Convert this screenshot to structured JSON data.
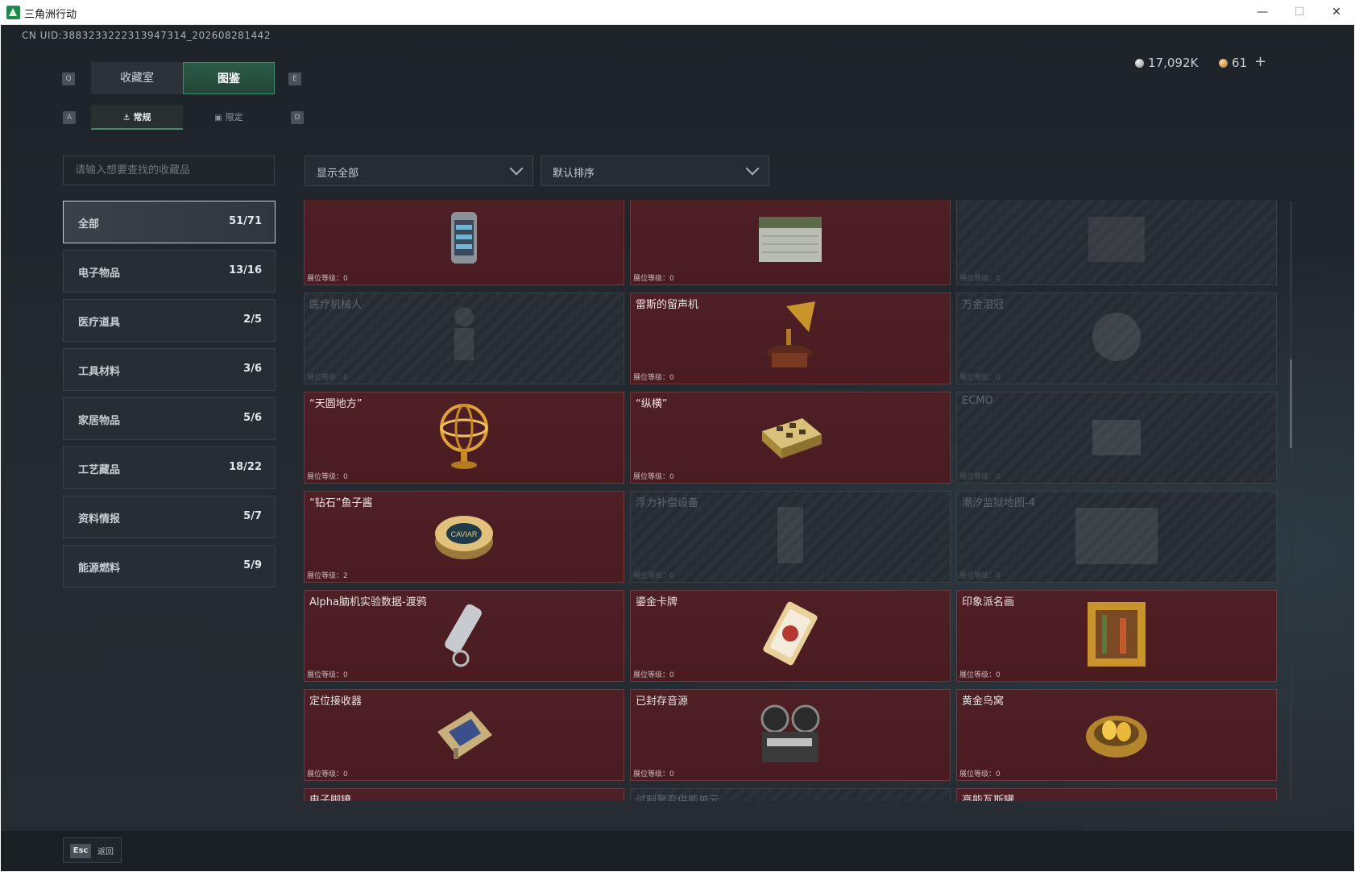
{
  "window": {
    "title": "三角洲行动"
  },
  "uid_text": "CN UID:3883233222313947314_202608281442",
  "currency": {
    "silver": "17,092K",
    "gold": "61",
    "add_label": "+"
  },
  "tabs": [
    {
      "label": "收藏室",
      "key": "Q"
    },
    {
      "label": "图鉴",
      "key": "E"
    }
  ],
  "subtabs": [
    {
      "label": "常规",
      "key": "A"
    },
    {
      "label": "限定",
      "key": "D"
    }
  ],
  "search": {
    "placeholder": "请输入想要查找的收藏品"
  },
  "filters": {
    "display": "显示全部",
    "sort": "默认排序"
  },
  "categories": [
    {
      "label": "全部",
      "count": "51/71"
    },
    {
      "label": "电子物品",
      "count": "13/16"
    },
    {
      "label": "医疗道具",
      "count": "2/5"
    },
    {
      "label": "工具材料",
      "count": "3/6"
    },
    {
      "label": "家居物品",
      "count": "5/6"
    },
    {
      "label": "工艺藏品",
      "count": "18/22"
    },
    {
      "label": "资料情报",
      "count": "5/7"
    },
    {
      "label": "能源燃料",
      "count": "5/9"
    }
  ],
  "level_prefix": "展位等级：",
  "items": [
    {
      "name": "",
      "level": "0",
      "owned": true,
      "icon": "server-core-icon"
    },
    {
      "name": "",
      "level": "0",
      "owned": true,
      "icon": "military-crate-icon"
    },
    {
      "name": "",
      "level": "0",
      "owned": false,
      "icon": "crate-icon"
    },
    {
      "name": "医疗机械人",
      "level": "0",
      "owned": false,
      "icon": "robot-icon"
    },
    {
      "name": "雷斯的留声机",
      "level": "0",
      "owned": true,
      "icon": "gramophone-icon"
    },
    {
      "name": "万金泪冠",
      "level": "0",
      "owned": false,
      "icon": "crown-icon"
    },
    {
      "name": "“天圆地方”",
      "level": "0",
      "owned": true,
      "icon": "armillary-sphere-icon"
    },
    {
      "name": "“纵横”",
      "level": "0",
      "owned": true,
      "icon": "chessboard-icon"
    },
    {
      "name": "ECMO",
      "level": "0",
      "owned": false,
      "icon": "ecmo-icon"
    },
    {
      "name": "“钻石”鱼子酱",
      "level": "2",
      "owned": true,
      "icon": "caviar-tin-icon"
    },
    {
      "name": "浮力补偿设备",
      "level": "0",
      "owned": false,
      "icon": "buoyancy-device-icon"
    },
    {
      "name": "潮汐监狱地图-4",
      "level": "0",
      "owned": false,
      "icon": "map-icon"
    },
    {
      "name": "Alpha脑机实验数据-渡鸦",
      "level": "0",
      "owned": true,
      "icon": "data-cylinder-icon"
    },
    {
      "name": "鎏金卡牌",
      "level": "0",
      "owned": true,
      "icon": "gilded-card-icon"
    },
    {
      "name": "印象派名画",
      "level": "0",
      "owned": true,
      "icon": "framed-painting-icon"
    },
    {
      "name": "定位接收器",
      "level": "0",
      "owned": true,
      "icon": "locator-receiver-icon"
    },
    {
      "name": "已封存音源",
      "level": "0",
      "owned": true,
      "icon": "tape-recorder-icon"
    },
    {
      "name": "黄金鸟窝",
      "level": "0",
      "owned": true,
      "icon": "golden-nest-icon"
    },
    {
      "name": "电子脚镣",
      "level": "0",
      "owned": true,
      "icon": "ankle-monitor-icon"
    },
    {
      "name": "试制聚变供能单元",
      "level": "0",
      "owned": false,
      "icon": "fusion-unit-icon"
    },
    {
      "name": "高能瓦斯罐",
      "level": "0",
      "owned": true,
      "icon": "gas-canister-icon"
    }
  ],
  "bottom": {
    "esc_key": "Esc",
    "esc_label": "返回"
  }
}
